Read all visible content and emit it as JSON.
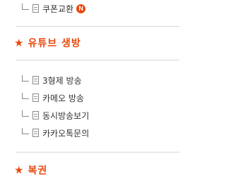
{
  "top_item": {
    "label": "쿠폰교환",
    "badge": "N"
  },
  "sections": [
    {
      "title": "유튜브 생방",
      "items": [
        {
          "label": "3형제 방송"
        },
        {
          "label": "카메오 방송"
        },
        {
          "label": "동시방송보기"
        },
        {
          "label": "카카오톡문의"
        }
      ]
    },
    {
      "title": "복권"
    }
  ]
}
